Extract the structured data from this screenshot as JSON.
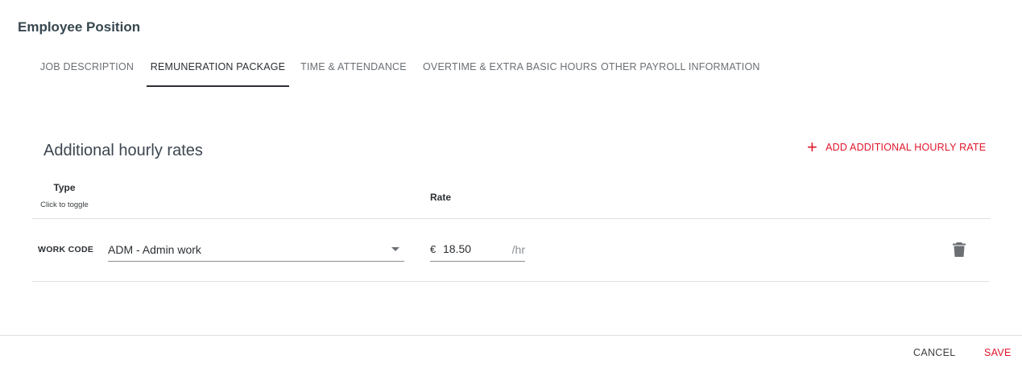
{
  "header": {
    "title": "Employee Position"
  },
  "tabs": [
    {
      "label": "JOB DESCRIPTION",
      "active": false
    },
    {
      "label": "REMUNERATION PACKAGE",
      "active": true
    },
    {
      "label": "TIME & ATTENDANCE",
      "active": false
    },
    {
      "label": "OVERTIME & EXTRA BASIC HOURS",
      "active": false
    },
    {
      "label": "OTHER PAYROLL INFORMATION",
      "active": false
    }
  ],
  "section": {
    "title": "Additional hourly rates",
    "add_label": "ADD ADDITIONAL HOURLY RATE",
    "add_icon": "plus-icon",
    "columns": {
      "type": "Type",
      "type_hint": "Click to toggle",
      "rate": "Rate"
    },
    "rows": [
      {
        "type_toggle": "WORK CODE",
        "work_code": "ADM - Admin work",
        "currency": "€",
        "rate": "18.50",
        "unit": "/hr",
        "delete_icon": "trash-icon"
      }
    ]
  },
  "footer": {
    "cancel_label": "CANCEL",
    "save_label": "SAVE"
  },
  "colors": {
    "accent": "#e0162b",
    "text": "#2b2f33",
    "muted": "#6b7075",
    "divider": "#e0e0e0"
  }
}
